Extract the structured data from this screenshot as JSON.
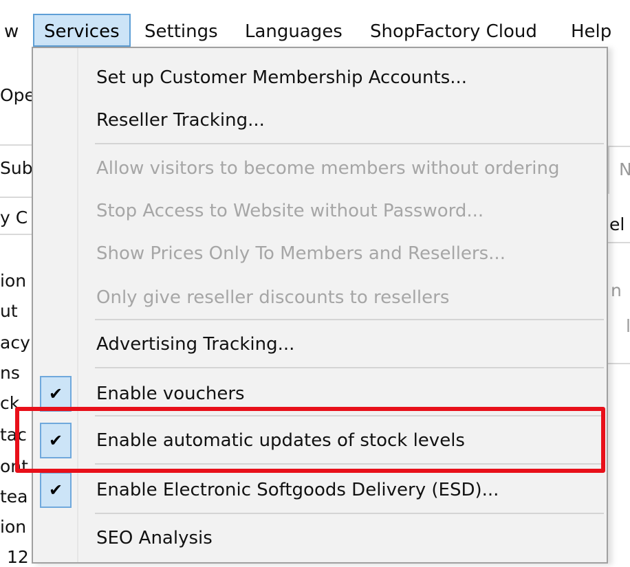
{
  "menubar": {
    "items": [
      "w",
      "Services",
      "Settings",
      "Languages",
      "ShopFactory Cloud",
      "Help"
    ]
  },
  "background": {
    "left_texts": [
      "Ope",
      "Sub",
      "y C",
      "ion",
      "ut",
      "acy",
      "ns",
      "ck",
      "tac",
      "ont",
      "tea",
      "ion",
      "12"
    ],
    "right_texts": [
      "N",
      "el",
      "n",
      "l"
    ]
  },
  "menu": {
    "items": [
      {
        "label": "Set up Customer Membership Accounts...",
        "enabled": true,
        "checked": false
      },
      {
        "label": "Reseller Tracking...",
        "enabled": true,
        "checked": false
      },
      {
        "label": "Allow visitors to become members without ordering",
        "enabled": false,
        "checked": false
      },
      {
        "label": "Stop Access to Website without Password...",
        "enabled": false,
        "checked": false
      },
      {
        "label": "Show Prices Only To Members and Resellers...",
        "enabled": false,
        "checked": false
      },
      {
        "label": "Only give reseller discounts to resellers",
        "enabled": false,
        "checked": false
      },
      {
        "label": "Advertising Tracking...",
        "enabled": true,
        "checked": false
      },
      {
        "label": "Enable vouchers",
        "enabled": true,
        "checked": true
      },
      {
        "label": "Enable automatic updates of stock levels",
        "enabled": true,
        "checked": true
      },
      {
        "label": "Enable Electronic Softgoods Delivery (ESD)...",
        "enabled": true,
        "checked": true
      },
      {
        "label": "SEO Analysis",
        "enabled": true,
        "checked": false
      }
    ],
    "check_glyph": "✔"
  },
  "colors": {
    "highlight_border": "#e8101a",
    "menu_selected_bg": "#cce4f7",
    "menu_selected_border": "#5e9fd6"
  }
}
